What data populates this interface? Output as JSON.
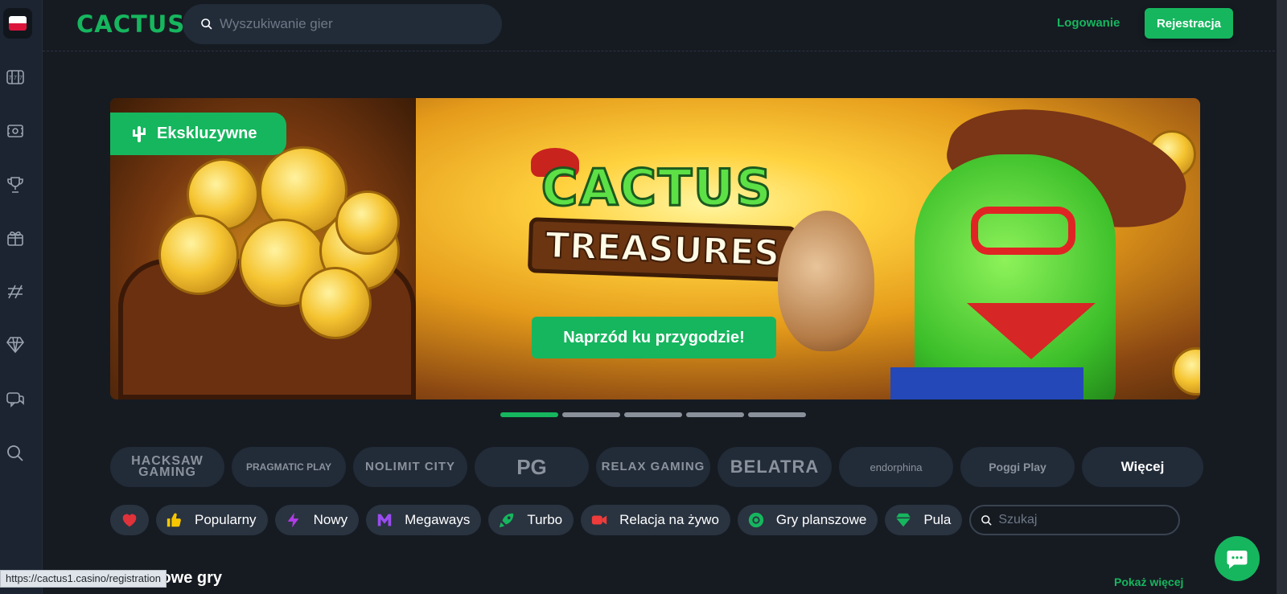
{
  "header": {
    "logo_text": "CACTUS",
    "search_placeholder": "Wyszukiwanie gier",
    "login_label": "Logowanie",
    "register_label": "Rejestracja"
  },
  "sidebar": {
    "language": "pl",
    "icons": [
      "slots-icon",
      "casino-chip-icon",
      "trophy-icon",
      "gift-icon",
      "sport-icon",
      "diamond-icon",
      "chat-icon",
      "search-icon"
    ]
  },
  "banner": {
    "badge_label": "Ekskluzywne",
    "game_title_line1": "CACTUS",
    "game_title_line2": "TREASURES",
    "cta_label": "Naprzód ku przygodzie!",
    "slides_total": 5,
    "active_slide": 1
  },
  "providers": [
    {
      "name": "HACKSAW GAMING"
    },
    {
      "name": "PRAGMATIC PLAY"
    },
    {
      "name": "NOLIMIT CITY"
    },
    {
      "name": "PG"
    },
    {
      "name": "RELAX GAMING"
    },
    {
      "name": "BELATRA"
    },
    {
      "name": "endorphina"
    },
    {
      "name": "Poggi Play"
    },
    {
      "name": "Więcej"
    }
  ],
  "categories": [
    {
      "label": "",
      "icon": "heart-icon"
    },
    {
      "label": "Popularny",
      "icon": "thumbs-up-icon"
    },
    {
      "label": "Nowy",
      "icon": "lightning-icon"
    },
    {
      "label": "Megaways",
      "icon": "megaways-icon"
    },
    {
      "label": "Turbo",
      "icon": "turbo-icon"
    },
    {
      "label": "Relacja na żywo",
      "icon": "live-icon"
    },
    {
      "label": "Gry planszowe",
      "icon": "board-games-icon"
    },
    {
      "label": "Pula",
      "icon": "jackpot-diamond-icon"
    }
  ],
  "category_search_placeholder": "Szukaj",
  "status_bar_url": "https://cactus1.casino/registration",
  "section": {
    "title": "Nowe gry",
    "more_label": "Pokaż więcej"
  },
  "colors": {
    "brand_green": "#16b65e",
    "background": "#161b22",
    "sidebar": "#1c2431",
    "pill": "#222b38"
  }
}
